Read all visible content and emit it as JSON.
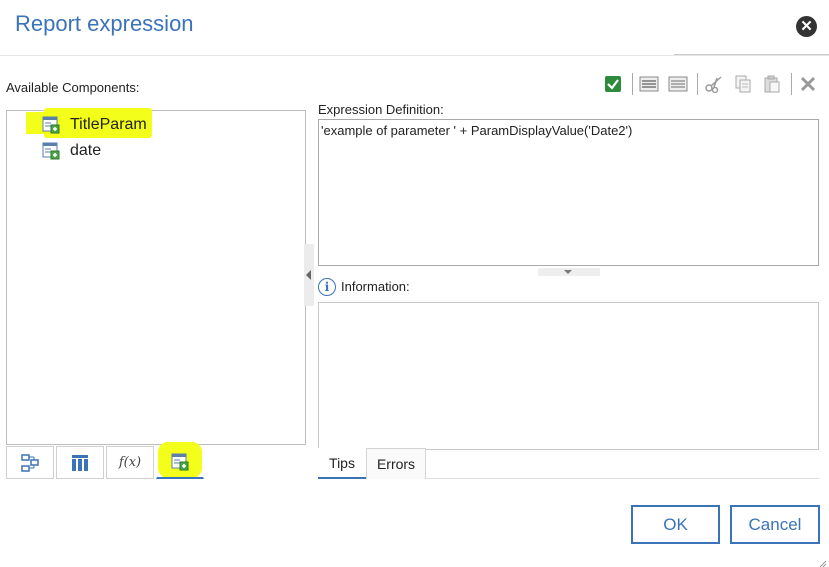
{
  "dialog": {
    "title": "Report expression",
    "close_label": "✕"
  },
  "left": {
    "available_label": "Available Components:",
    "tree_items": [
      {
        "label": "TitleParam",
        "icon": "parameter-icon",
        "highlighted": true
      },
      {
        "label": "date",
        "icon": "parameter-icon",
        "highlighted": false
      }
    ],
    "bottom_tabs": [
      {
        "name": "data-items-tab",
        "icon": "tree-structure-icon"
      },
      {
        "name": "columns-tab",
        "icon": "columns-icon"
      },
      {
        "name": "functions-tab",
        "icon": "function-icon",
        "icon_text": "f(x)"
      },
      {
        "name": "parameters-tab",
        "icon": "parameter-icon",
        "active": true,
        "highlighted": true
      }
    ]
  },
  "toolbar": {
    "buttons": [
      {
        "name": "validate-button",
        "icon": "check-icon"
      },
      {
        "name": "comment-button",
        "icon": "comment-lines-icon"
      },
      {
        "name": "uncomment-button",
        "icon": "uncomment-lines-icon"
      },
      {
        "name": "cut-button",
        "icon": "scissors-icon"
      },
      {
        "name": "copy-button",
        "icon": "copy-icon"
      },
      {
        "name": "paste-button",
        "icon": "paste-icon"
      },
      {
        "name": "delete-button",
        "icon": "x-icon"
      }
    ]
  },
  "expression": {
    "label": "Expression Definition:",
    "value": "'example of parameter ' + ParamDisplayValue('Date2')"
  },
  "information": {
    "label": "Information:",
    "icon_glyph": "i"
  },
  "info_tabs": [
    {
      "label": "Tips",
      "active": true
    },
    {
      "label": "Errors",
      "active": false
    }
  ],
  "buttons": {
    "ok": "OK",
    "cancel": "Cancel"
  },
  "colors": {
    "accent": "#3b73b9",
    "highlight": "#f3ff1a",
    "check_green": "#2e8b3e"
  }
}
